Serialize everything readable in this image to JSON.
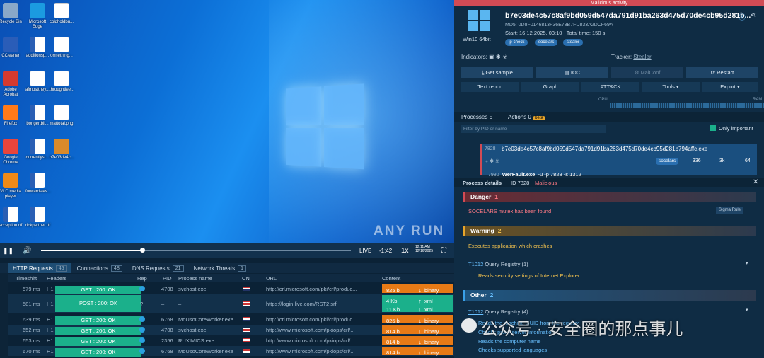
{
  "vm": {
    "desktop_icons": [
      {
        "label": "Recycle Bin",
        "color": "#8aa8c8",
        "kind": "bin"
      },
      {
        "label": "Microsoft Edge",
        "color": "#1b9be0",
        "kind": "app"
      },
      {
        "label": "coldholdbu...",
        "kind": "doc"
      },
      {
        "label": "CCleaner",
        "color": "#2a5db8",
        "kind": "app"
      },
      {
        "label": "additionsp...",
        "kind": "word"
      },
      {
        "label": "ormething...",
        "kind": "doc"
      },
      {
        "label": "Adobe Acrobat",
        "color": "#d43a2f",
        "kind": "app"
      },
      {
        "label": "afmostthey...",
        "kind": "doc"
      },
      {
        "label": "throughtiee...",
        "kind": "doc"
      },
      {
        "label": "Firefox",
        "color": "#ff7a1a",
        "kind": "app"
      },
      {
        "label": "bongertbll...",
        "kind": "word"
      },
      {
        "label": "mattotal.png",
        "kind": "doc"
      },
      {
        "label": "Google Chrome",
        "color": "#e8453c",
        "kind": "app"
      },
      {
        "label": "currentlyst...",
        "kind": "word"
      },
      {
        "label": "b7e03de4c...",
        "color": "#d98a2b",
        "kind": "app"
      },
      {
        "label": "VLC media player",
        "color": "#f08a18",
        "kind": "app"
      },
      {
        "label": "forwardsies...",
        "kind": "word"
      },
      {
        "label": "acception.rtf",
        "kind": "word"
      },
      {
        "label": "rickpartner.rtf",
        "kind": "word"
      }
    ],
    "watermark": "ANY RUN",
    "player": {
      "live": "LIVE",
      "time": "-1:42",
      "speed": "1x",
      "clock": "12:11 AM 12/16/2025"
    }
  },
  "network": {
    "tabs": [
      {
        "label": "HTTP Requests",
        "count": "45"
      },
      {
        "label": "Connections",
        "count": "48"
      },
      {
        "label": "DNS Requests",
        "count": "21"
      },
      {
        "label": "Network Threats",
        "count": "1"
      }
    ],
    "columns": {
      "timeshift": "Timeshift",
      "headers": "Headers",
      "rep": "Rep",
      "pid": "PID",
      "process": "Process name",
      "cn": "CN",
      "url": "URL",
      "content": "Content"
    },
    "rows": [
      {
        "time": "579 ms",
        "ver": "H1",
        "method": "GET  :  200: OK",
        "rep": "ok",
        "pid": "4708",
        "proc": "svchost.exe",
        "flag": "nl",
        "url": "http://crl.microsoft.com/pki/crl/produc...",
        "content": [
          {
            "size": "825 b",
            "arrow": "↓",
            "type": "binary",
            "color": "orange"
          }
        ]
      },
      {
        "time": "581 ms",
        "ver": "H1",
        "method": "POST  :  200: OK",
        "rep": "?",
        "pid": "–",
        "proc": "–",
        "flag": "us",
        "url": "https://login.live.com/RST2.srf",
        "content": [
          {
            "size": "4 Kb",
            "arrow": "↑",
            "type": "xml",
            "color": "green"
          },
          {
            "size": "11 Kb",
            "arrow": "↓",
            "type": "xml",
            "color": "green"
          }
        ]
      },
      {
        "time": "639 ms",
        "ver": "H1",
        "method": "GET  :  200: OK",
        "rep": "ok",
        "pid": "6768",
        "proc": "MoUsoCoreWorker.exe",
        "flag": "nl",
        "url": "http://crl.microsoft.com/pki/crl/produc...",
        "content": [
          {
            "size": "825 b",
            "arrow": "↓",
            "type": "binary",
            "color": "orange"
          }
        ]
      },
      {
        "time": "652 ms",
        "ver": "H1",
        "method": "GET  :  200: OK",
        "rep": "ok",
        "pid": "4708",
        "proc": "svchost.exe",
        "flag": "us",
        "url": "http://www.microsoft.com/pkiops/crl/...",
        "content": [
          {
            "size": "814 b",
            "arrow": "↓",
            "type": "binary",
            "color": "orange"
          }
        ]
      },
      {
        "time": "653 ms",
        "ver": "H1",
        "method": "GET  :  200: OK",
        "rep": "ok",
        "pid": "2356",
        "proc": "RUXIMICS.exe",
        "flag": "us",
        "url": "http://www.microsoft.com/pkiops/crl/...",
        "content": [
          {
            "size": "814 b",
            "arrow": "↓",
            "type": "binary",
            "color": "orange"
          }
        ]
      },
      {
        "time": "670 ms",
        "ver": "H1",
        "method": "GET  :  200: OK",
        "rep": "ok",
        "pid": "6768",
        "proc": "MoUsoCoreWorker.exe",
        "flag": "us",
        "url": "http://www.microsoft.com/pkiops/crl/...",
        "content": [
          {
            "size": "814 b",
            "arrow": "↓",
            "type": "binary",
            "color": "orange"
          }
        ]
      }
    ]
  },
  "analysis": {
    "banner": "Malicious activity",
    "os_label": "Win10 64bit",
    "hash": "b7e03de4c57c8af9bd059d547da791d91ba263d475d70de4cb95d281b...",
    "md5": "MD5: 0D8F0146813F36E78B7FD833A2DCF69A",
    "start": "Start: 16.12.2025, 03:10",
    "total": "Total time: 150 s",
    "tags": [
      "ip-check",
      "socelars",
      "stealer"
    ],
    "indicators": "Indicators:",
    "tracker_label": "Tracker:",
    "tracker_value": "Stealer",
    "buttons": [
      "Get sample",
      "IOC",
      "MalConf",
      "Restart"
    ],
    "buttons2": [
      "Text report",
      "Graph",
      "ATT&CK",
      "Tools",
      "Export"
    ],
    "cpu": "CPU",
    "ram": "RAM",
    "processes": "Processes",
    "processes_count": "5",
    "actions": "Actions",
    "actions_count": "0",
    "beta": "beta",
    "filter_placeholder": "Filter by PID or name",
    "only_important": "Only important",
    "proc_pid": "7828",
    "proc_name": "b7e03de4c57c8af9bd059d547da791d91ba263d475d70de4cb95d281b794affc.exe",
    "proc_tag": "socelars",
    "proc_stats": [
      "336",
      "3k",
      "64"
    ],
    "child_pid": "7980",
    "child_name": "WerFault.exe",
    "child_args": "-u -p 7828 -s 1312",
    "pd_label": "Process details",
    "pd_id": "ID 7828",
    "pd_status": "Malicious",
    "danger": "Danger",
    "danger_count": "1",
    "danger_item": "SOCELARS mutex has been found",
    "sigma": "Sigma Rule",
    "warning": "Warning",
    "warning_count": "2",
    "warning_item": "Executes application which crashes",
    "t1012a": "T1012",
    "t1012a_text": "Query Registry (1)",
    "ie_item": "Reads security settings of Internet Explorer",
    "other": "Other",
    "other_count": "2",
    "t1012b": "T1012",
    "t1012b_text": "Query Registry (4)",
    "other_items": [
      "Reads the machine GUID from the registry",
      "Checks proxy server information",
      "Reads the computer name",
      "Checks supported languages"
    ]
  },
  "overlay_watermark": "公众号 · 安全圈的那点事儿"
}
